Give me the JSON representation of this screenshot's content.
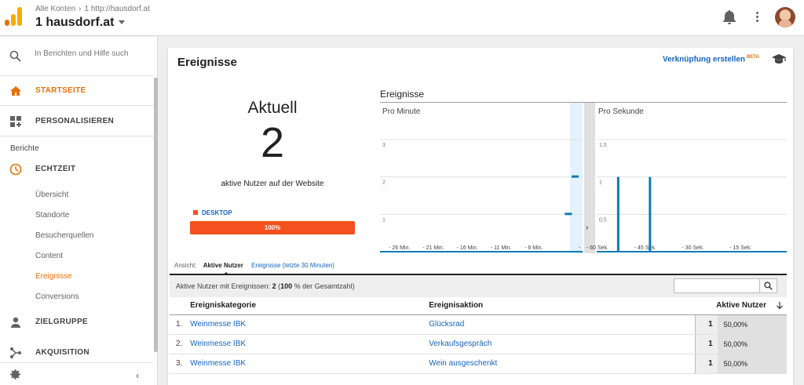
{
  "header": {
    "breadcrumb": [
      "Alle Konten",
      "1 http://hausdorf.at"
    ],
    "account": "1 hausdorf.at"
  },
  "sidebar": {
    "search_placeholder": "In Berichten und Hilfe such",
    "items": [
      {
        "label": "STARTSEITE",
        "icon": "home-icon"
      },
      {
        "label": "PERSONALISIEREN",
        "icon": "dashboard-icon"
      }
    ],
    "section_label": "Berichte",
    "echtzeit": {
      "label": "ECHTZEIT",
      "icon": "clock-icon"
    },
    "sub_items": [
      "Übersicht",
      "Standorte",
      "Besucherquellen",
      "Content",
      "Ereignisse",
      "Conversions"
    ],
    "selected_sub_item": "Ereignisse",
    "more": [
      {
        "label": "ZIELGRUPPE",
        "icon": "person-icon"
      },
      {
        "label": "AKQUISITION",
        "icon": "acquisition-icon"
      }
    ]
  },
  "main": {
    "title": "Ereignisse",
    "link_label": "Verknüpfung erstellen",
    "link_badge": "BETA",
    "aktuell_label": "Aktuell",
    "active_users": "2",
    "active_users_label": "aktive Nutzer auf der Website",
    "device_label": "DESKTOP",
    "device_percent": "100%",
    "device_fraction": 1.0
  },
  "chart_data": [
    {
      "type": "bar",
      "title": "Ereignisse",
      "panel": "Pro Minute",
      "categories": [
        "- 26 Min.",
        "- 21 Min.",
        "- 16 Min.",
        "- 11 Min.",
        "- 6 Min.",
        "-"
      ],
      "y_ticks": [
        "3",
        "2",
        "1"
      ],
      "ylim": [
        0,
        3
      ],
      "bars": [
        {
          "minutes_ago": 1,
          "value": 1
        },
        {
          "minutes_ago": 0,
          "value": 2
        }
      ]
    },
    {
      "type": "bar",
      "panel": "Pro Sekunde",
      "categories": [
        "- 60 Sek.",
        "- 45 Sek.",
        "- 30 Sek.",
        "- 15 Sek."
      ],
      "y_ticks": [
        "1,5",
        "1",
        "0,5"
      ],
      "ylim": [
        0,
        1.5
      ],
      "bars": [
        {
          "seconds_ago": 53,
          "value": 1
        },
        {
          "seconds_ago": 43,
          "value": 1
        }
      ]
    }
  ],
  "table": {
    "view_label": "Ansicht:",
    "view_active": "Aktive Nutzer",
    "view_alt": "Ereignisse (letzte 30 Minuten)",
    "summary_prefix": "Aktive Nutzer mit Ereignissen:",
    "summary_count": "2",
    "summary_pct": "100",
    "summary_suffix": "% der Gesamtzahl)",
    "columns": [
      "Ereigniskategorie",
      "Ereignisaktion",
      "Aktive Nutzer"
    ],
    "rows": [
      {
        "n": "1.",
        "category": "Weinmesse IBK",
        "action": "Glücksrad",
        "value": "1",
        "pct": "50,00%"
      },
      {
        "n": "2.",
        "category": "Weinmesse IBK",
        "action": "Verkaufsgespräch",
        "value": "1",
        "pct": "50,00%"
      },
      {
        "n": "3.",
        "category": "Weinmesse IBK",
        "action": "Wein ausgeschenkt",
        "value": "1",
        "pct": "50,00%"
      }
    ]
  },
  "colors": {
    "accent_orange": "#e8710a",
    "desktop_bar": "#f4511e",
    "chart_bar": "#0b7bb8",
    "link_blue": "#1565c0"
  }
}
